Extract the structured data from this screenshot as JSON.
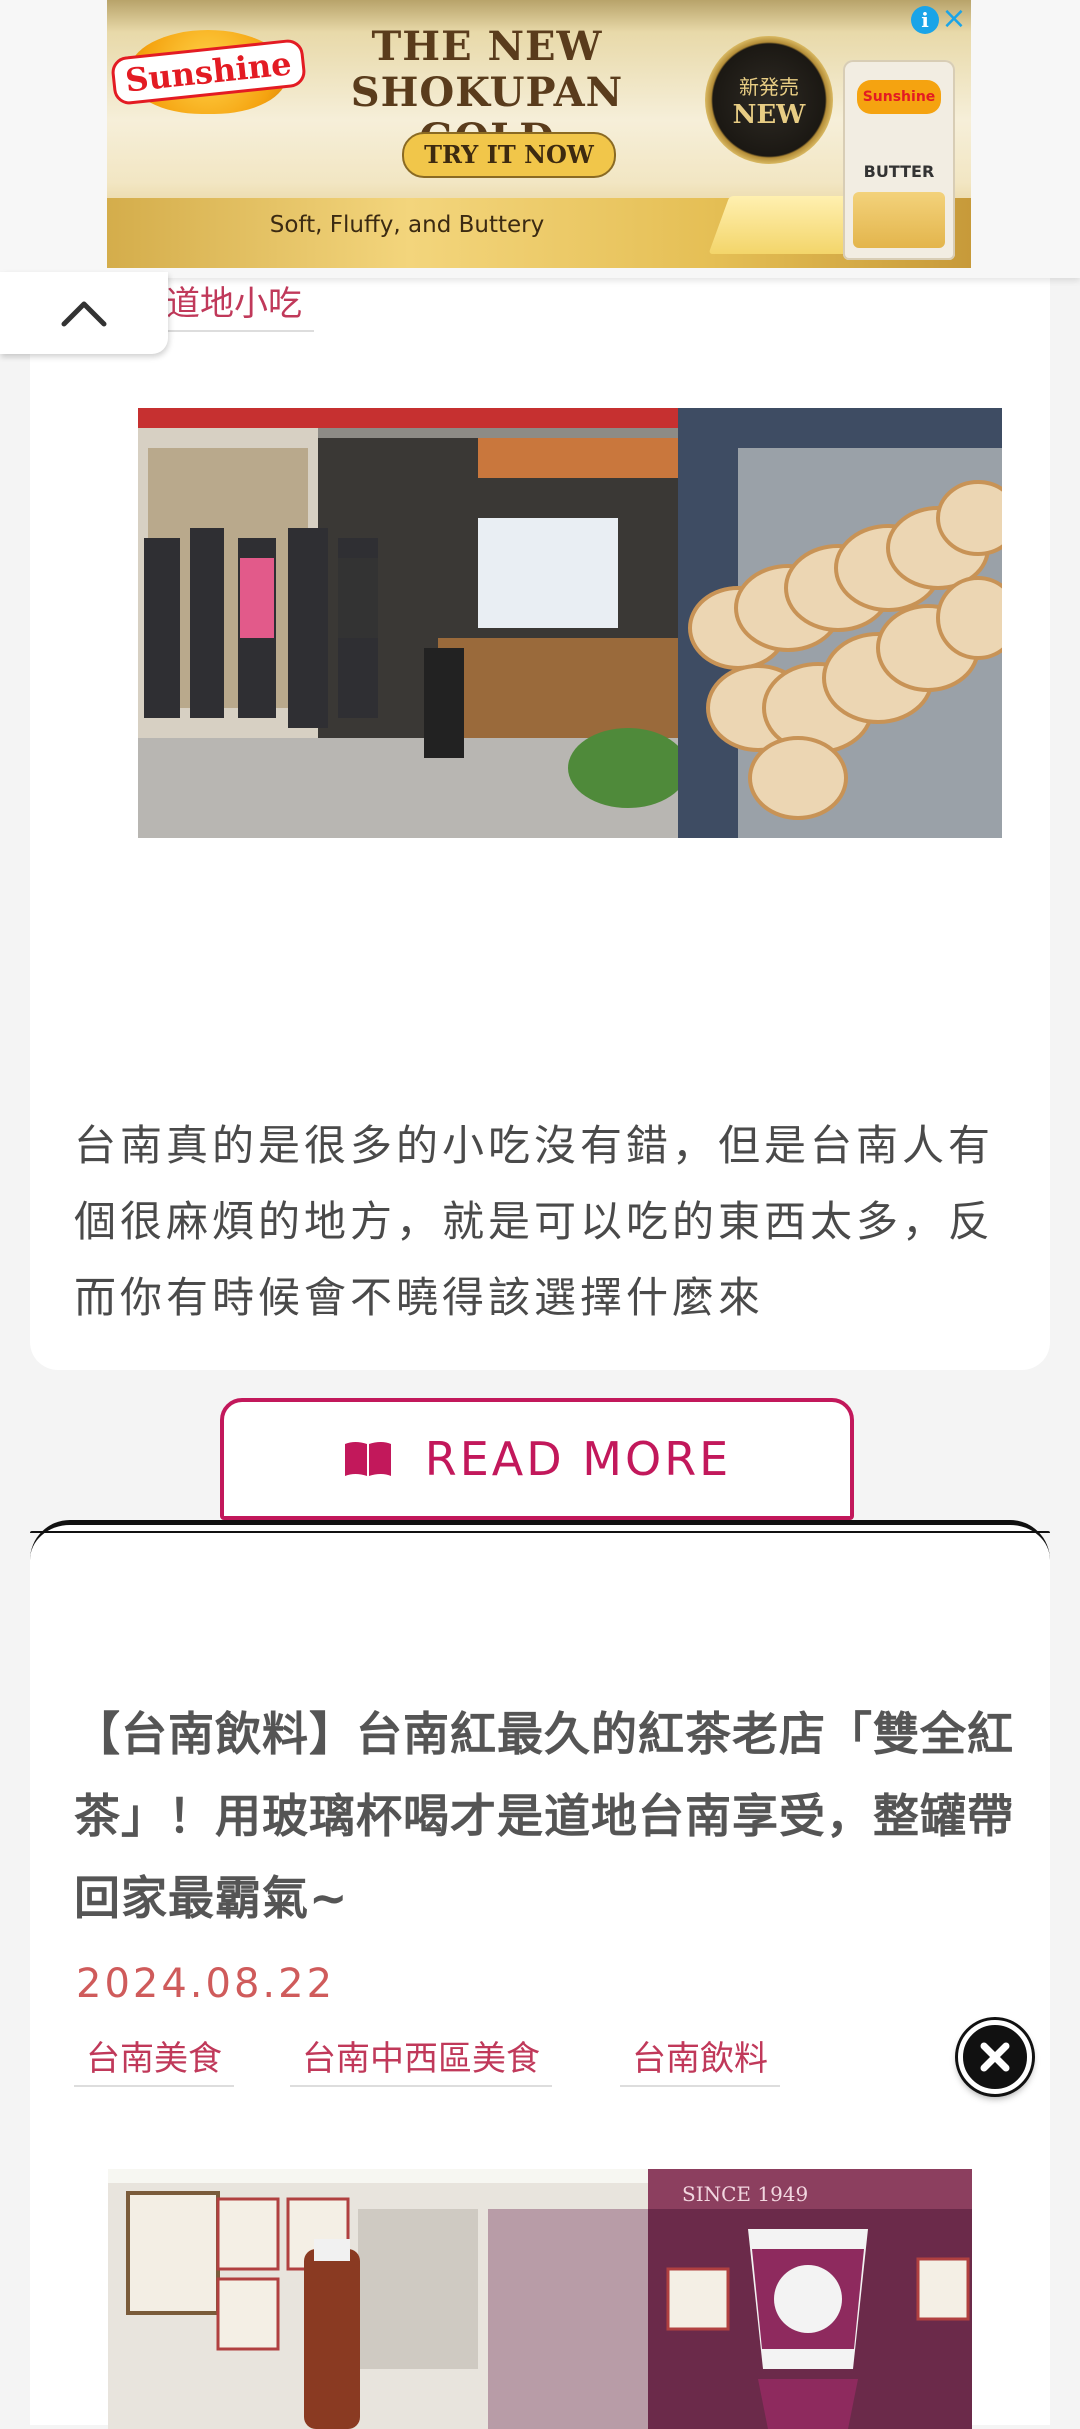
{
  "ad": {
    "brand": "Sunshine",
    "headline_line1": "THE NEW",
    "headline_line2": "SHOKUPAN GOLD",
    "cta": "TRY IT NOW",
    "tagline": "Soft, Fluffy, and Buttery",
    "seal_text_jp": "新発売",
    "seal_text": "NEW",
    "package_brand": "Sunshine",
    "package_label": "BUTTER",
    "info_icon": "i",
    "close_icon": "×"
  },
  "card1": {
    "tag": "道地小吃",
    "excerpt": "台南真的是很多的小吃沒有錯，但是台南人有個很麻煩的地方，就是可以吃的東西太多，反而你有時候會不曉得該選擇什麼來",
    "read_more": "READ MORE"
  },
  "card2": {
    "title": "【台南飲料】台南紅最久的紅茶老店「雙全紅茶」！用玻璃杯喝才是道地台南享受，整罐帶回家最霸氣~",
    "date": "2024.08.22",
    "tags": [
      "台南美食",
      "台南中西區美食",
      "台南飲料"
    ],
    "sign_text": "SINCE 1949"
  },
  "colors": {
    "accent": "#c2185b",
    "tag_text": "#c0395a",
    "date_text": "#cf5b5b",
    "ad_info": "#1aa4e8"
  }
}
